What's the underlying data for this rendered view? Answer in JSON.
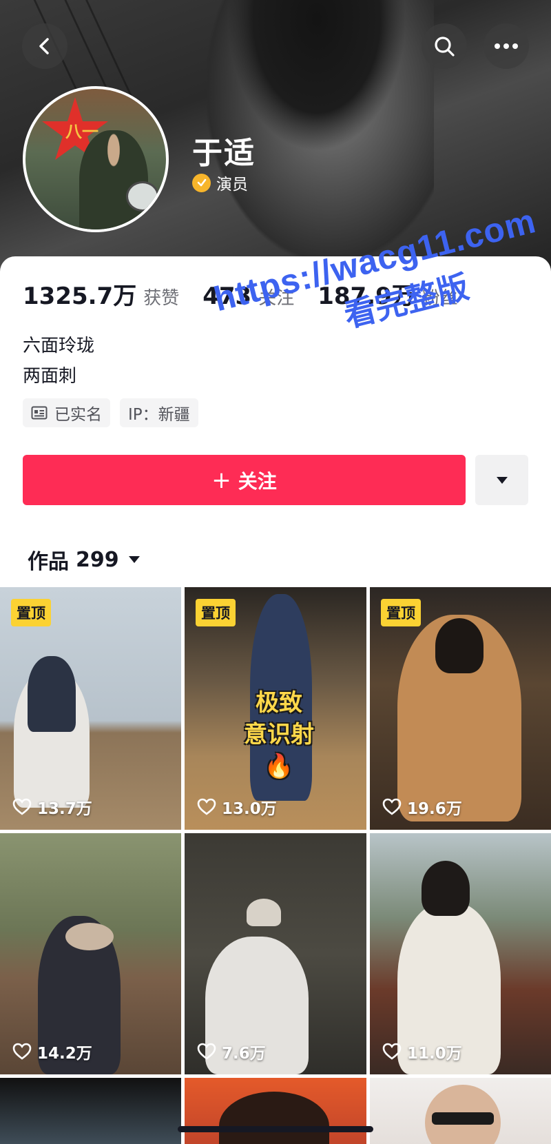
{
  "header": {
    "back_icon": "chevron-left-icon",
    "search_icon": "search-icon",
    "more_icon": "more-dots-icon",
    "name": "于适",
    "verified_label": "演员",
    "avatar_text": "八一"
  },
  "stats": [
    {
      "value": "1325.7万",
      "label": "获赞"
    },
    {
      "value": "473",
      "label": "关注"
    },
    {
      "value": "187.9万",
      "label": "粉丝"
    }
  ],
  "bio": {
    "line1": "六面玲珑",
    "line2": "两面刺"
  },
  "tags": [
    {
      "icon": "id-card-icon",
      "label": "已实名"
    },
    {
      "icon": "",
      "label": "IP：新疆"
    }
  ],
  "actions": {
    "follow_label": "关注",
    "follow_plus": "+"
  },
  "works": {
    "label": "作品",
    "count": "299"
  },
  "videos": [
    {
      "pinned": "置顶",
      "likes": "13.7万"
    },
    {
      "pinned": "置顶",
      "likes": "13.0万",
      "overlay_line1": "极致",
      "overlay_line2": "意识射🔥"
    },
    {
      "pinned": "置顶",
      "likes": "19.6万"
    },
    {
      "likes": "14.2万"
    },
    {
      "likes": "7.6万"
    },
    {
      "likes": "11.0万"
    }
  ],
  "watermark": {
    "line1": "https://wacg11.com",
    "line2": "看完整版"
  },
  "colors": {
    "follow": "#fe2c55",
    "verify": "#f7b52b",
    "pin": "#fbd233",
    "watermark": "#3d63f0"
  }
}
